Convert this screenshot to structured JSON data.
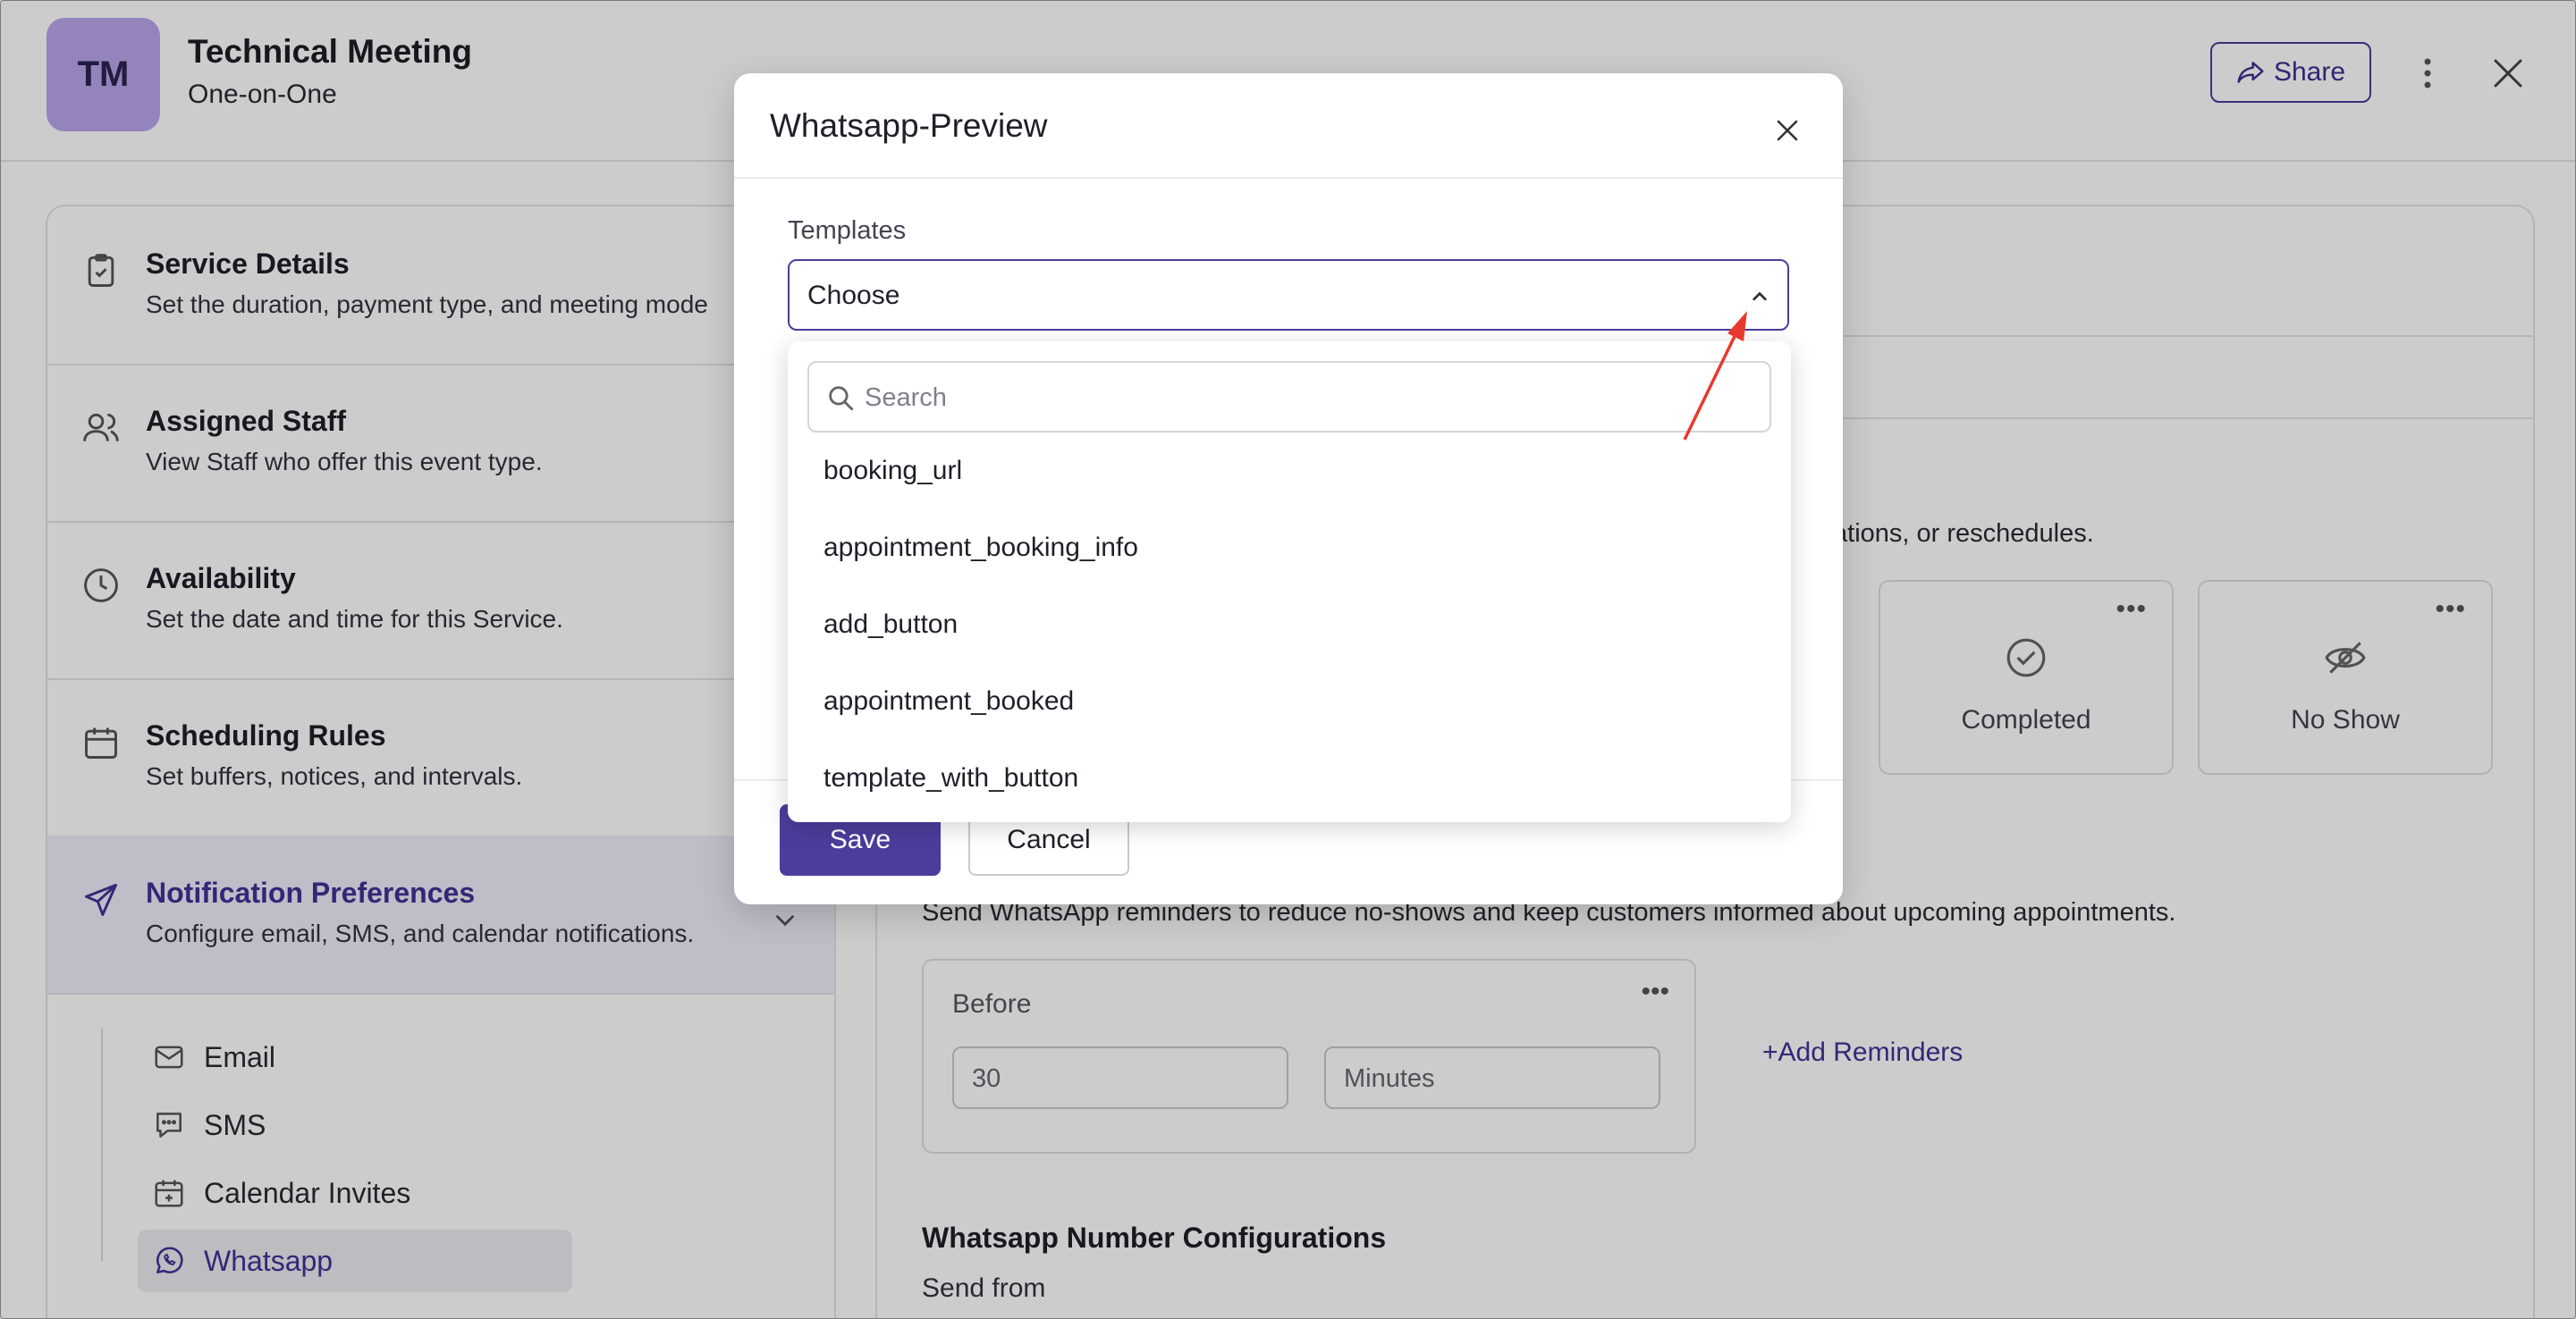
{
  "header": {
    "avatar_initials": "TM",
    "title": "Technical Meeting",
    "subtitle": "One-on-One",
    "share_label": "Share",
    "more_icon": "more-vertical-icon",
    "close_icon": "close-icon"
  },
  "sidebar": {
    "items": [
      {
        "title": "Service Details",
        "desc": "Set the duration, payment type, and meeting mode",
        "icon": "clipboard-icon"
      },
      {
        "title": "Assigned Staff",
        "desc": "View Staff who offer this event type.",
        "icon": "users-icon"
      },
      {
        "title": "Availability",
        "desc": "Set the date and time for this Service.",
        "icon": "clock-icon"
      },
      {
        "title": "Scheduling Rules",
        "desc": "Set buffers, notices, and intervals.",
        "icon": "calendar-icon"
      },
      {
        "title": "Notification Preferences",
        "desc": "Configure email, SMS, and calendar notifications.",
        "icon": "send-icon"
      }
    ],
    "sub_items": [
      {
        "label": "Email",
        "icon": "mail-icon"
      },
      {
        "label": "SMS",
        "icon": "chat-icon"
      },
      {
        "label": "Calendar Invites",
        "icon": "calendar-plus-icon"
      },
      {
        "label": "Whatsapp",
        "icon": "whatsapp-icon"
      }
    ]
  },
  "main": {
    "cancellation_text": "ellations, or reschedules.",
    "status_cards": [
      {
        "label": "Completed",
        "icon": "check-circle-icon"
      },
      {
        "label": "No Show",
        "icon": "eye-off-icon"
      }
    ],
    "reminder_desc": "Send WhatsApp reminders to reduce no-shows and keep customers informed about upcoming appointments.",
    "before_label": "Before",
    "before_value": "30",
    "before_unit": "Minutes",
    "add_reminders": "Add Reminders",
    "wa_config_title": "Whatsapp Number Configurations",
    "wa_config_sub": "Send from"
  },
  "modal": {
    "title": "Whatsapp-Preview",
    "templates_label": "Templates",
    "select_value": "Choose",
    "search_placeholder": "Search",
    "options": [
      "booking_url",
      "appointment_booking_info",
      "add_button",
      "appointment_booked",
      "template_with_button"
    ],
    "save_label": "Save",
    "cancel_label": "Cancel"
  },
  "colors": {
    "accent": "#4c3d9c",
    "annotation_arrow": "#e8392d"
  }
}
